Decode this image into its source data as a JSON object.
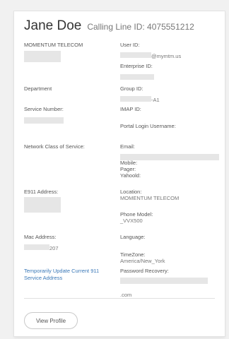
{
  "header": {
    "name": "Jane Doe",
    "calling_line_id": "Calling Line ID: 4075551212"
  },
  "left": {
    "company": "MOMENTUM TELECOM",
    "department_label": "Department",
    "service_number_label": "Service Number:",
    "network_cos_label": "Network Class of Service:",
    "e911_label": "E911 Address:",
    "mac_label": "Mac Address:",
    "mac_value_suffix": "207",
    "temp_update_link": "Temporarily Update Current 911 Service Address"
  },
  "right": {
    "user_id_label": "User ID:",
    "user_id_domain": "@mymtm.us",
    "enterprise_id_label": "Enterprise ID:",
    "group_id_label": "Group ID:",
    "group_id_suffix": "-A1",
    "imap_id_label": "IMAP ID:",
    "portal_login_label": "Portal Login Username:",
    "email_label": "Email:",
    "mobile_label": "Mobile:",
    "pager_label": "Pager:",
    "yahoo_label": "Yahoold:",
    "location_label": "Location:",
    "location_value": "MOMENTUM TELECOM",
    "phone_model_label": "Phone Model:",
    "phone_model_value": "_VVX500",
    "language_label": "Language:",
    "timezone_label": "TimeZone:",
    "timezone_value": "America/New_York",
    "password_recovery_label": "Password Recovery:",
    "password_recovery_suffix": ".com"
  },
  "actions": {
    "view_profile_label": "View Profile"
  }
}
